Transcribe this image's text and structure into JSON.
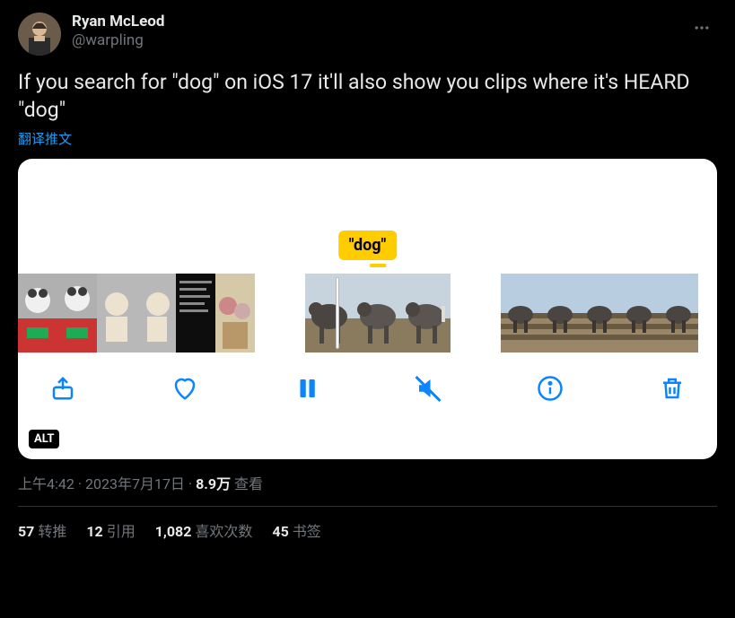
{
  "user": {
    "display_name": "Ryan McLeod",
    "handle": "@warpling"
  },
  "tweet_text": "If you search for \"dog\" on iOS 17 it'll also show you clips where it's HEARD \"dog\"",
  "translate_label": "翻译推文",
  "media": {
    "search_tag": "\"dog\"",
    "alt_badge": "ALT",
    "icons": {
      "share": "share-icon",
      "like": "heart-icon",
      "pause": "pause-icon",
      "mute": "mute-icon",
      "info": "info-icon",
      "delete": "trash-icon"
    }
  },
  "metadata": {
    "time": "上午4:42",
    "date": "2023年7月17日",
    "views_count": "8.9万",
    "views_label": "查看",
    "separator": " · "
  },
  "stats": {
    "retweets": {
      "count": "57",
      "label": "转推"
    },
    "quotes": {
      "count": "12",
      "label": "引用"
    },
    "likes": {
      "count": "1,082",
      "label": "喜欢次数"
    },
    "bookmarks": {
      "count": "45",
      "label": "书签"
    }
  }
}
